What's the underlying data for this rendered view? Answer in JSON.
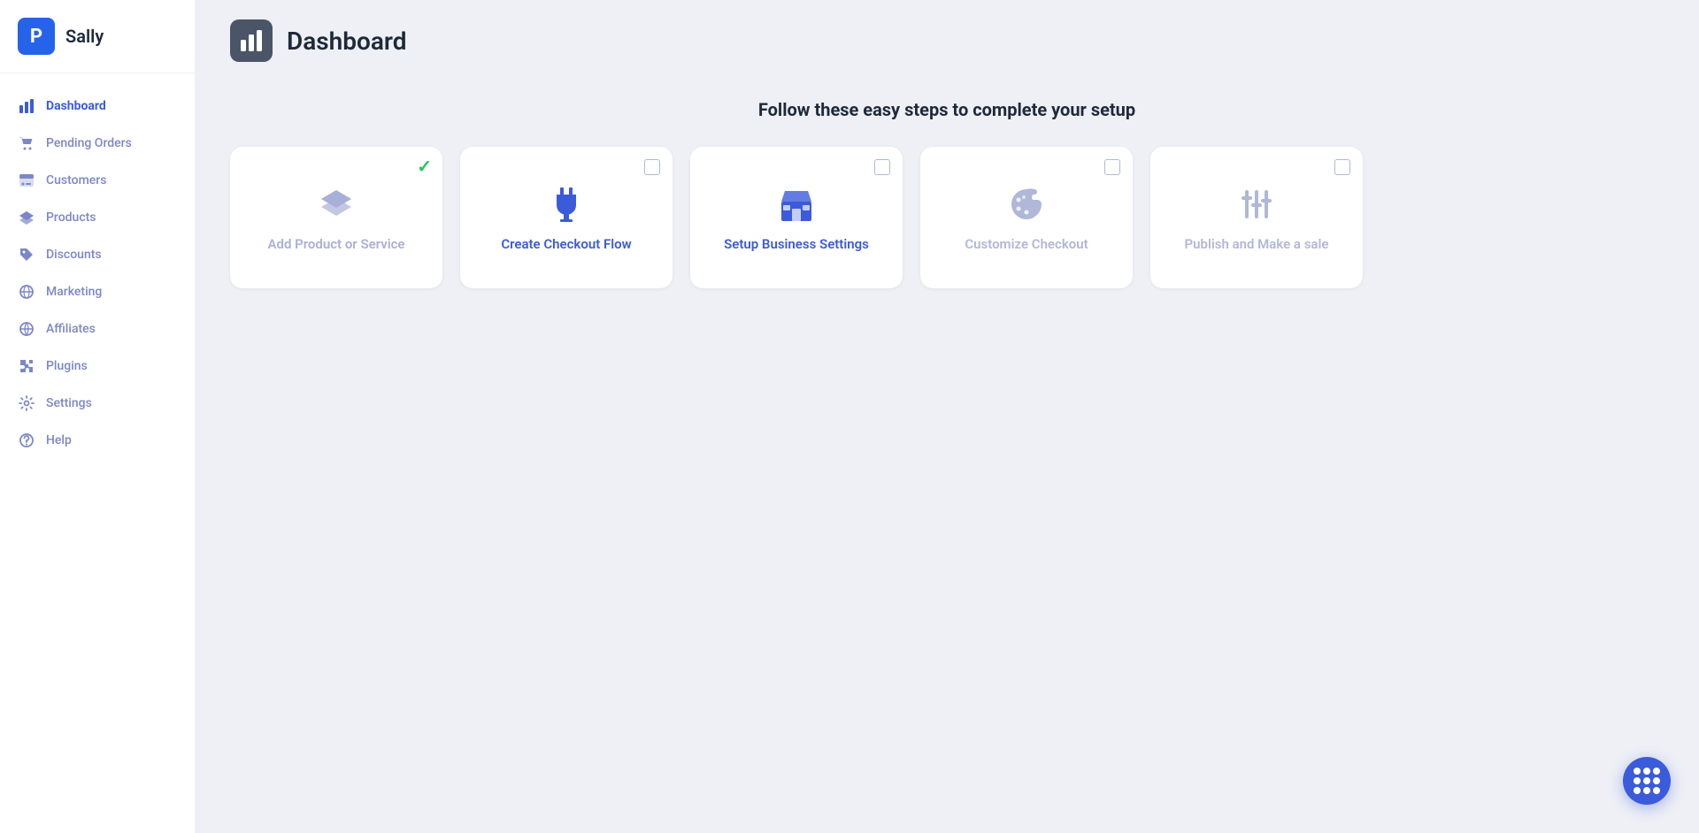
{
  "sidebar": {
    "logo_letter": "P",
    "username": "Sally",
    "items": [
      {
        "id": "dashboard",
        "label": "Dashboard",
        "icon": "bar-chart",
        "active": true
      },
      {
        "id": "pending-orders",
        "label": "Pending Orders",
        "icon": "cart"
      },
      {
        "id": "customers",
        "label": "Customers",
        "icon": "customers"
      },
      {
        "id": "products",
        "label": "Products",
        "icon": "layers"
      },
      {
        "id": "discounts",
        "label": "Discounts",
        "icon": "tag"
      },
      {
        "id": "marketing",
        "label": "Marketing",
        "icon": "marketing"
      },
      {
        "id": "affiliates",
        "label": "Affiliates",
        "icon": "globe"
      },
      {
        "id": "plugins",
        "label": "Plugins",
        "icon": "puzzle"
      },
      {
        "id": "settings",
        "label": "Settings",
        "icon": "settings"
      },
      {
        "id": "help",
        "label": "Help",
        "icon": "help"
      }
    ]
  },
  "header": {
    "title": "Dashboard",
    "icon": "bar-chart"
  },
  "main": {
    "setup_heading": "Follow these easy steps to complete your setup",
    "steps": [
      {
        "id": "add-product",
        "label": "Add Product or Service",
        "icon": "layers",
        "state": "done",
        "checked": true
      },
      {
        "id": "create-checkout",
        "label": "Create Checkout Flow",
        "icon": "plug",
        "state": "active-blue",
        "checked": false
      },
      {
        "id": "setup-business",
        "label": "Setup Business Settings",
        "icon": "store",
        "state": "active-blue2",
        "checked": false
      },
      {
        "id": "customize-checkout",
        "label": "Customize Checkout",
        "icon": "palette",
        "state": "muted",
        "checked": false
      },
      {
        "id": "publish-sale",
        "label": "Publish and Make a sale",
        "icon": "sliders",
        "state": "muted",
        "checked": false
      }
    ]
  },
  "fab": {
    "label": "Apps menu"
  },
  "colors": {
    "active_blue": "#3b5bdb",
    "muted": "#b0b8d8",
    "done_color": "#a8b0d8",
    "checkmark_green": "#22c55e",
    "sidebar_bg": "#ffffff",
    "main_bg": "#eef0f5"
  }
}
